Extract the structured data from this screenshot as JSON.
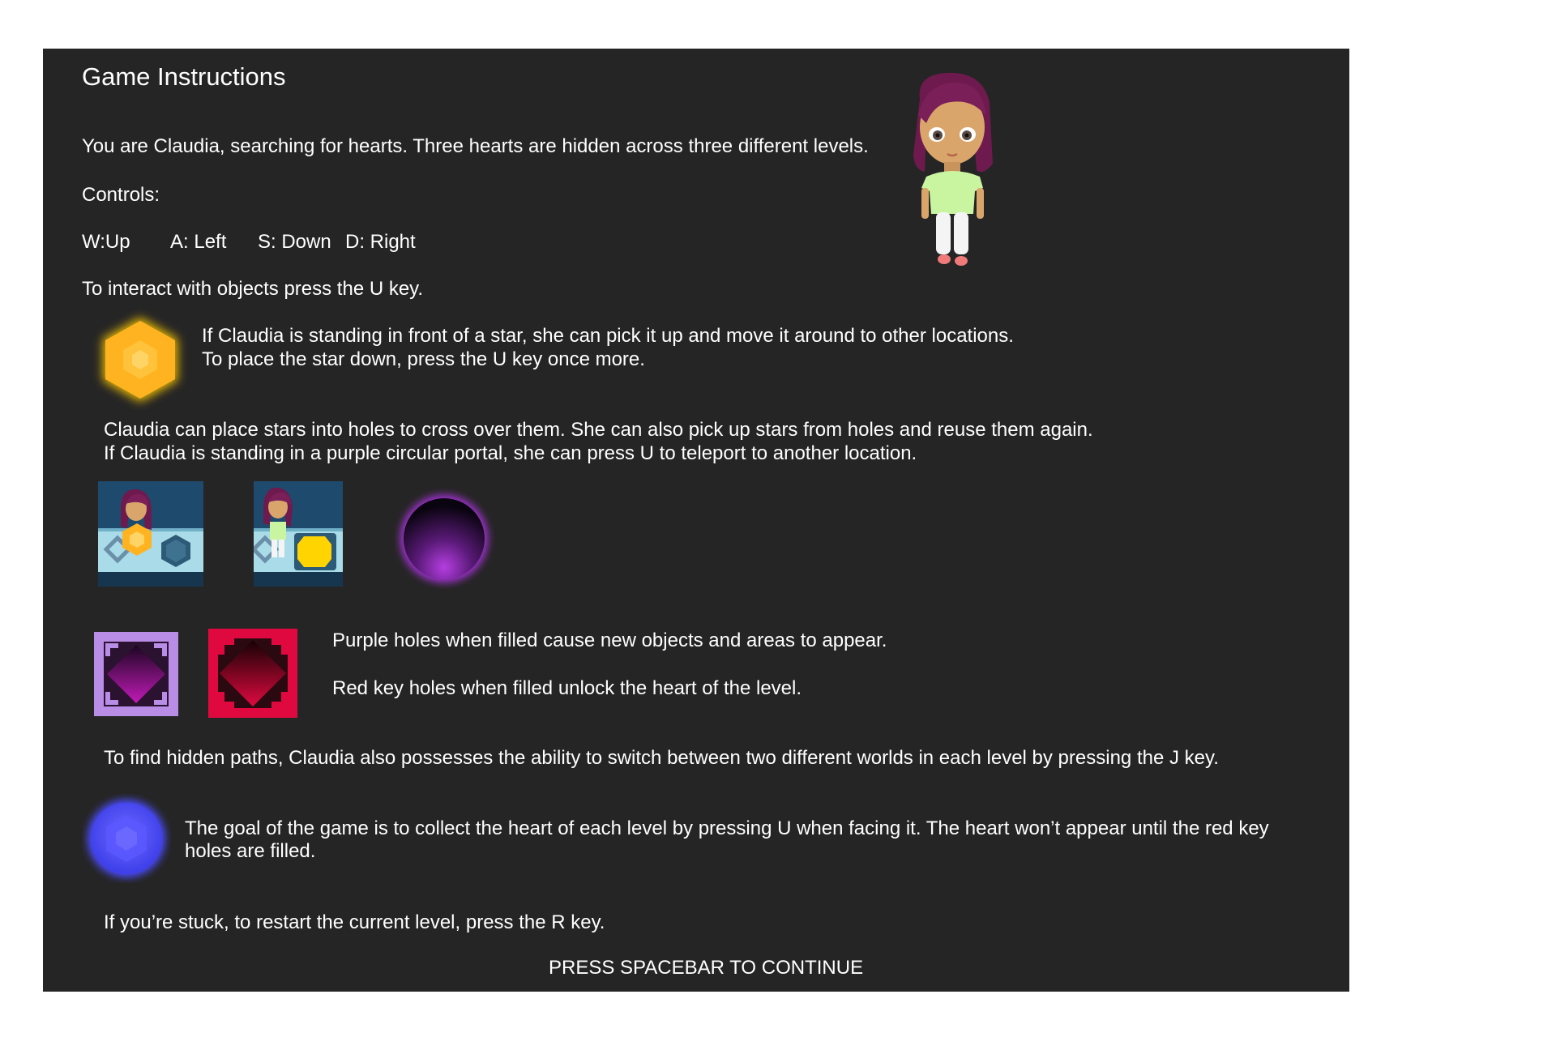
{
  "title": "Game Instructions",
  "intro": "You are Claudia, searching for hearts. Three hearts are hidden across three different levels.",
  "controls_heading": "Controls:",
  "controls": {
    "up": "W:Up",
    "left": "A: Left",
    "down": "S: Down",
    "right": "D: Right"
  },
  "interact": "To interact with objects press the U key.",
  "star_section": {
    "line1": "If Claudia is standing in front of a star, she can pick it up and move it around to other locations.",
    "line2": "To place the star down, press the U key once more."
  },
  "holes_section": {
    "line1": "Claudia can place stars into holes to cross over them. She can also pick up stars from holes and reuse them again.",
    "line2": "If Claudia is standing in a purple circular portal, she can press U to teleport to another location."
  },
  "keyholes": {
    "purple": "Purple holes when filled cause new objects and areas to appear.",
    "red": "Red key holes when filled unlock the heart of the level."
  },
  "worlds": "To find hidden paths, Claudia also possesses the ability to switch between two different worlds in each level by pressing the J key.",
  "goal": {
    "line1": "The goal of the game is to collect the heart of each level by pressing U when facing it. The heart won’t appear until the red key",
    "line2": "holes are filled."
  },
  "restart": "If you’re stuck, to restart the current level, press the R key.",
  "continue_prompt": "PRESS SPACEBAR TO CONTINUE",
  "icons": {
    "character": "claudia-character",
    "star": "star-hexagon-icon",
    "portal": "purple-portal-icon",
    "purple_hole": "purple-keyhole-icon",
    "red_hole": "red-keyhole-icon",
    "heart": "blue-heart-gem-icon"
  },
  "colors": {
    "panel": "#252525",
    "star": "#ffb320",
    "portal": "#a430d6",
    "purple_hole": "#b98ce6",
    "red_hole": "#e0093f",
    "heart": "#4b4bff"
  }
}
